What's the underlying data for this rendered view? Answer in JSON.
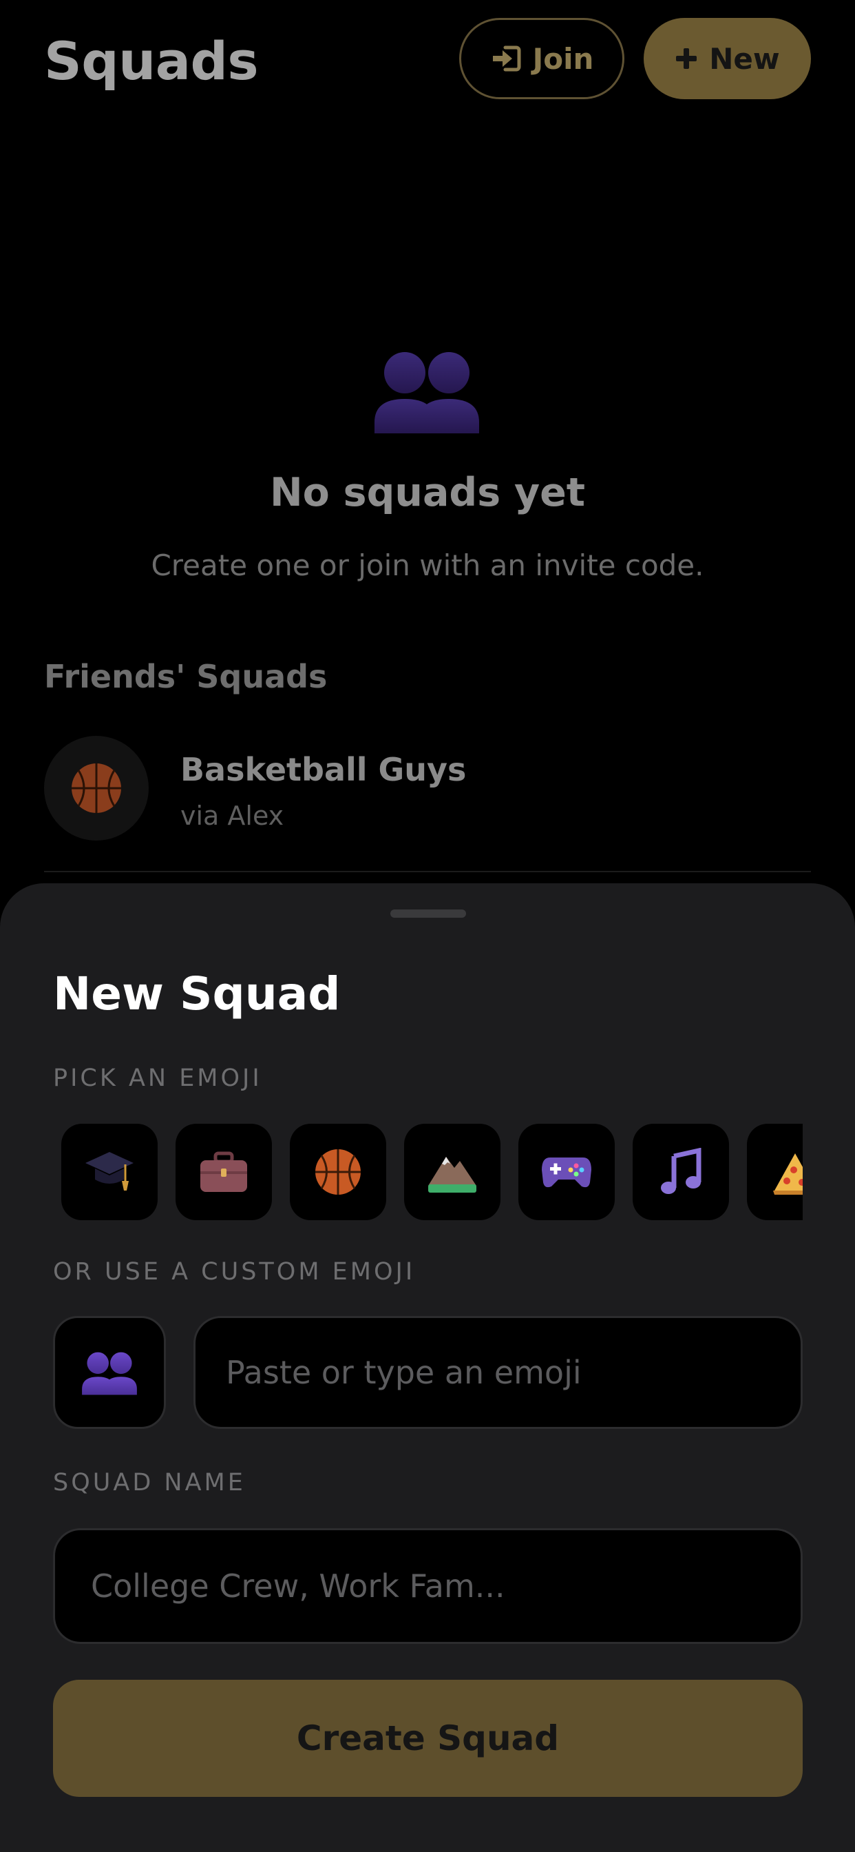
{
  "header": {
    "title": "Squads",
    "join_label": "Join",
    "new_label": "New"
  },
  "empty_state": {
    "icon": "people-silhouette-icon",
    "title": "No squads yet",
    "subtitle": "Create one or join with an invite code."
  },
  "friends": {
    "section_title": "Friends' Squads",
    "items": [
      {
        "name": "Basketball Guys",
        "via": "via Alex",
        "icon": "basketball-icon"
      }
    ]
  },
  "sheet": {
    "title": "New Squad",
    "pick_label": "PICK AN EMOJI",
    "emojis": [
      "graduation-cap",
      "briefcase",
      "basketball",
      "mountain",
      "game-controller",
      "music-note",
      "pizza"
    ],
    "custom_label": "OR USE A CUSTOM EMOJI",
    "custom_preview_icon": "people-silhouette-icon",
    "emoji_input_placeholder": "Paste or type an emoji",
    "name_label": "SQUAD NAME",
    "name_input_placeholder": "College Crew, Work Fam...",
    "create_label": "Create Squad"
  },
  "colors": {
    "accent": "#6b5a30",
    "accent_border": "#5f5233",
    "sheet_bg": "#1c1c1e",
    "tile_bg": "#000000"
  }
}
